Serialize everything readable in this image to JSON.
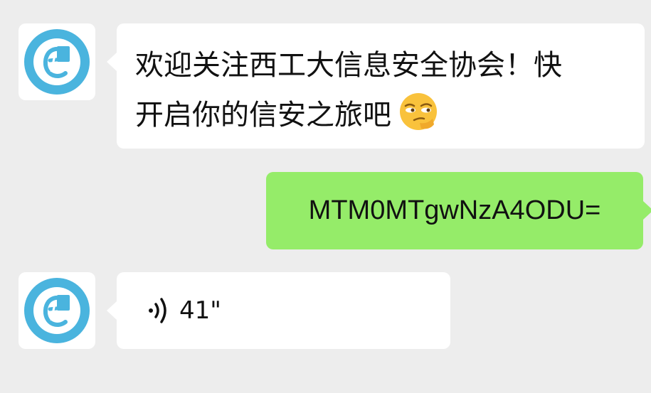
{
  "messages": [
    {
      "direction": "incoming",
      "text_line1": "欢迎关注西工大信息安全协会！快",
      "text_line2": "开启你的信安之旅吧",
      "emoji": "smirk-face-emoji"
    },
    {
      "direction": "outgoing",
      "text": "MTM0MTgwNzA4ODU="
    },
    {
      "direction": "incoming",
      "type": "voice",
      "duration": "41\""
    }
  ],
  "colors": {
    "background": "#ededed",
    "incoming_bubble": "#ffffff",
    "outgoing_bubble": "#95ec69",
    "avatar_ring": "#4ab4de"
  }
}
